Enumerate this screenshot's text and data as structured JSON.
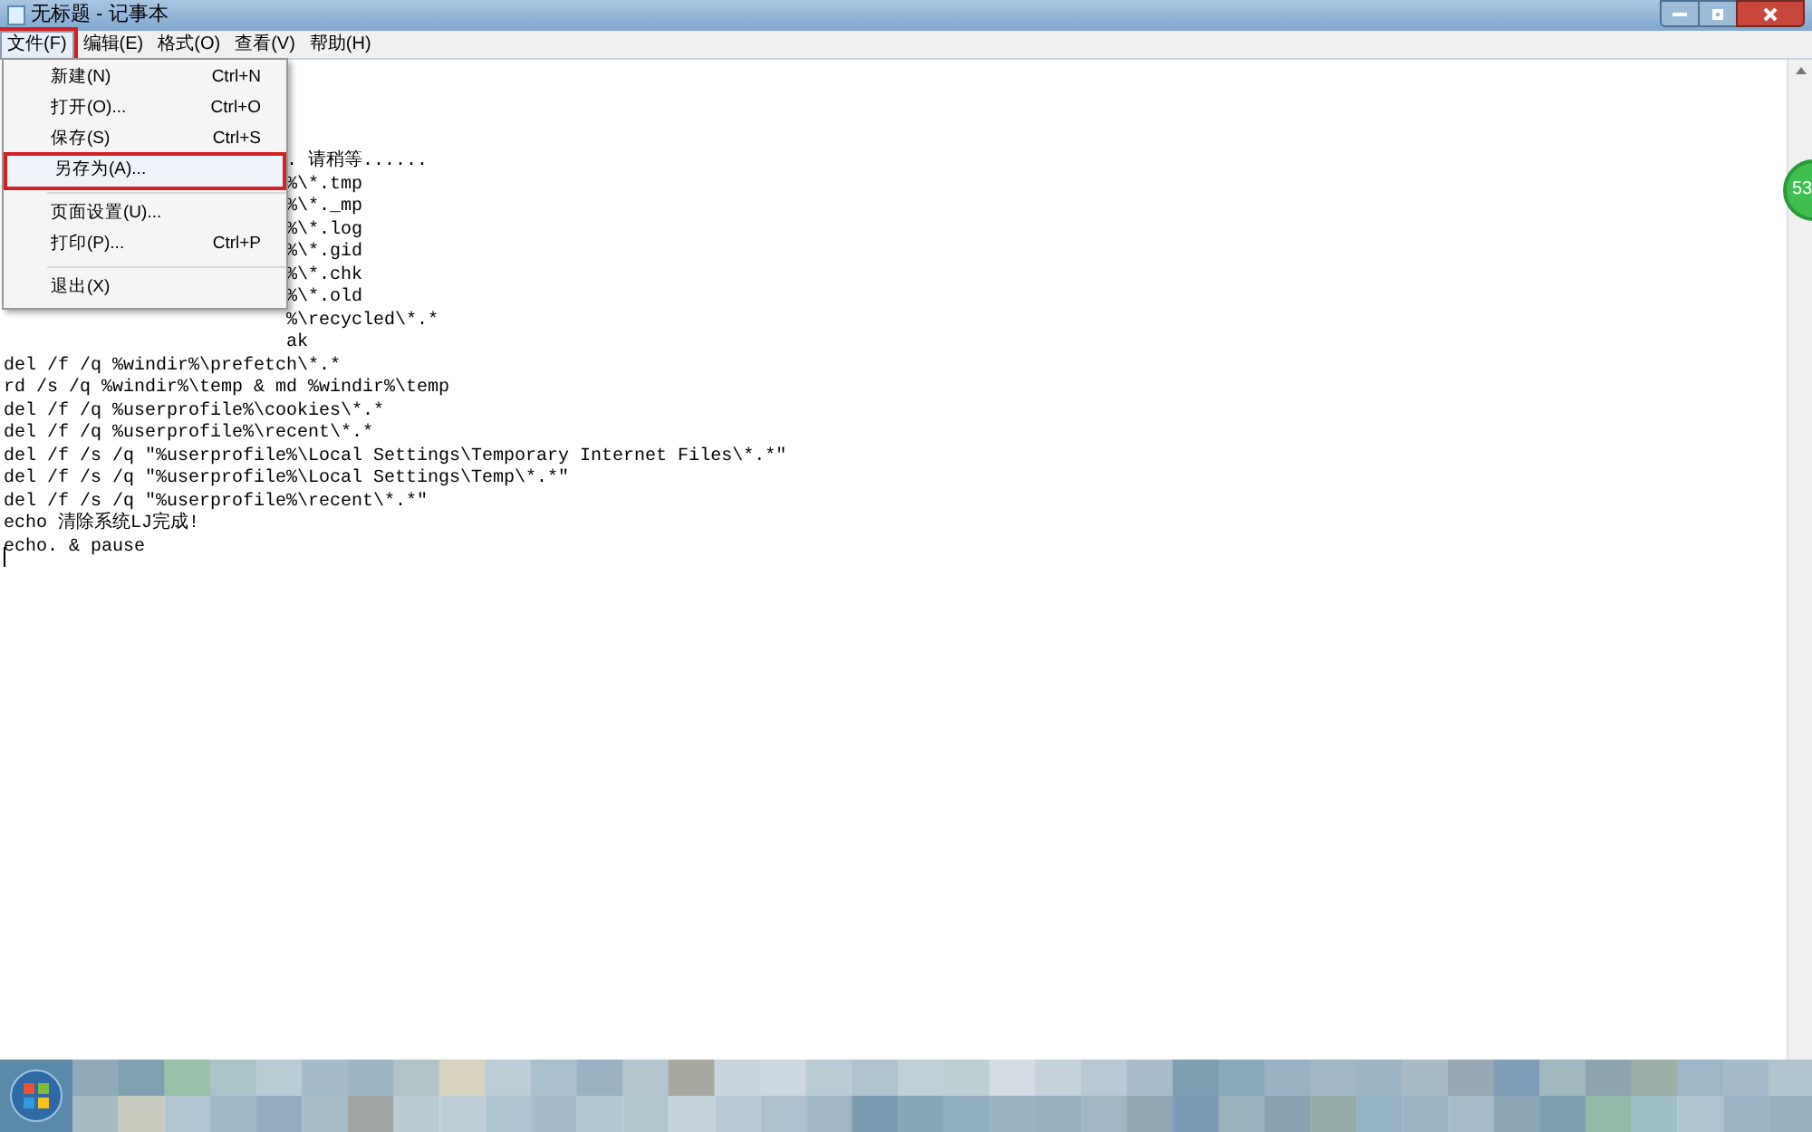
{
  "window": {
    "title": "无标题 - 记事本"
  },
  "menu_bar": [
    {
      "label": "文件(F)",
      "selected": true,
      "marked": true
    },
    {
      "label": "编辑(E)",
      "selected": false,
      "marked": false
    },
    {
      "label": "格式(O)",
      "selected": false,
      "marked": false
    },
    {
      "label": "查看(V)",
      "selected": false,
      "marked": false
    },
    {
      "label": "帮助(H)",
      "selected": false,
      "marked": false
    }
  ],
  "file_menu": [
    {
      "kind": "item",
      "label": "新建(N)",
      "shortcut": "Ctrl+N",
      "marked": false
    },
    {
      "kind": "item",
      "label": "打开(O)...",
      "shortcut": "Ctrl+O",
      "marked": false
    },
    {
      "kind": "item",
      "label": "保存(S)",
      "shortcut": "Ctrl+S",
      "marked": false
    },
    {
      "kind": "item",
      "label": "另存为(A)...",
      "marked": true
    },
    {
      "kind": "separator"
    },
    {
      "kind": "item",
      "label": "页面设置(U)...",
      "marked": false
    },
    {
      "kind": "item",
      "label": "打印(P)...",
      "shortcut": "Ctrl+P",
      "marked": false
    },
    {
      "kind": "separator"
    },
    {
      "kind": "item",
      "label": "退出(X)",
      "marked": false
    }
  ],
  "editor_lines": [
    {
      "text": ". 请稍等......",
      "covered": true
    },
    {
      "text": "%\\*.tmp",
      "covered": true
    },
    {
      "text": "%\\*._mp",
      "covered": true
    },
    {
      "text": "%\\*.log",
      "covered": true
    },
    {
      "text": "%\\*.gid",
      "covered": true
    },
    {
      "text": "%\\*.chk",
      "covered": true
    },
    {
      "text": "%\\*.old",
      "covered": true
    },
    {
      "text": "%\\recycled\\*.*",
      "covered": true
    },
    {
      "text": "ak",
      "covered": true
    },
    {
      "text": "del /f /q %windir%\\prefetch\\*.*",
      "covered": false
    },
    {
      "text": "rd /s /q %windir%\\temp & md %windir%\\temp",
      "covered": false
    },
    {
      "text": "del /f /q %userprofile%\\cookies\\*.*",
      "covered": false
    },
    {
      "text": "del /f /q %userprofile%\\recent\\*.*",
      "covered": false
    },
    {
      "text": "del /f /s /q \"%userprofile%\\Local Settings\\Temporary Internet Files\\*.*\"",
      "covered": false
    },
    {
      "text": "del /f /s /q \"%userprofile%\\Local Settings\\Temp\\*.*\"",
      "covered": false
    },
    {
      "text": "del /f /s /q \"%userprofile%\\recent\\*.*\"",
      "covered": false
    },
    {
      "text": "echo 清除系统LJ完成!",
      "covered": false
    },
    {
      "text": "echo. & pause",
      "covered": false
    }
  ],
  "floating_badge": "53"
}
